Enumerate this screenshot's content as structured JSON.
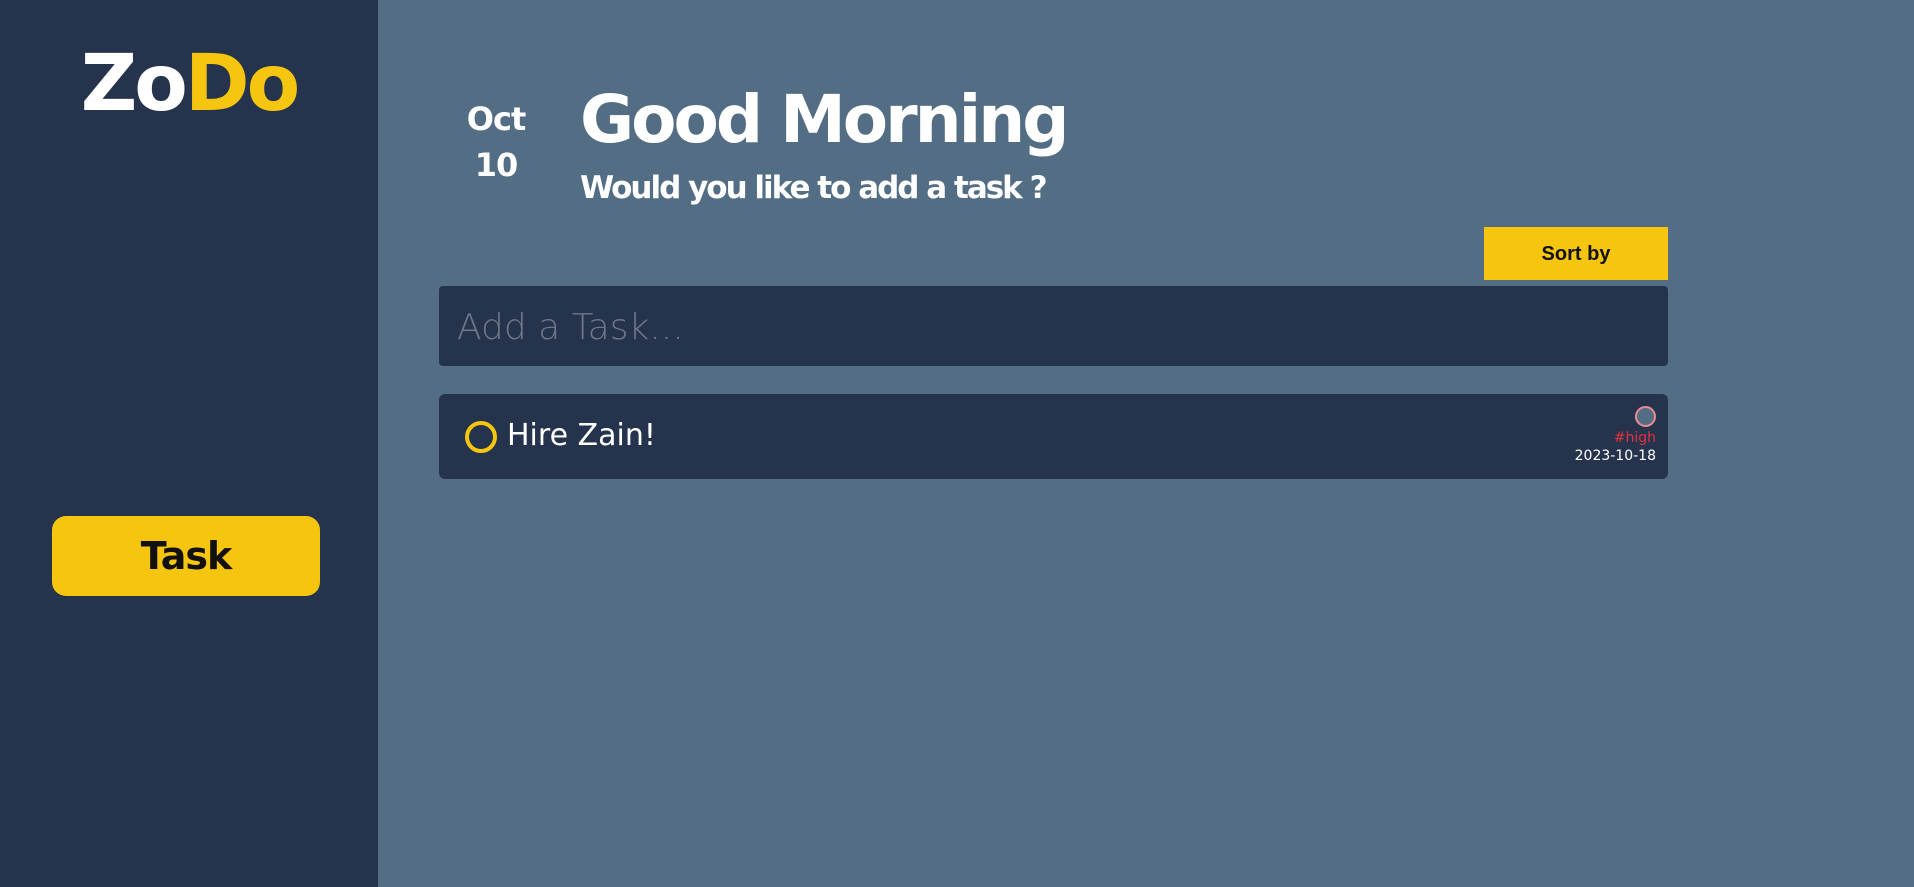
{
  "sidebar": {
    "logo": {
      "part1": "Zo",
      "part2": "Do"
    },
    "nav_task_label": "Task"
  },
  "header": {
    "month": "Oct",
    "day": "10",
    "greeting": "Good Morning",
    "subtitle": "Would you like to add a task ?"
  },
  "toolbar": {
    "sort_label": "Sort by"
  },
  "add_task": {
    "placeholder": "Add a Task...",
    "value": ""
  },
  "tasks": [
    {
      "title": "Hire Zain!",
      "priority_tag": "#high",
      "due_date": "2023-10-18",
      "completed": false
    }
  ],
  "colors": {
    "sidebar_bg": "#25344c",
    "main_bg": "#536d84",
    "accent": "#f5c50f",
    "priority_high": "#e4323c"
  }
}
